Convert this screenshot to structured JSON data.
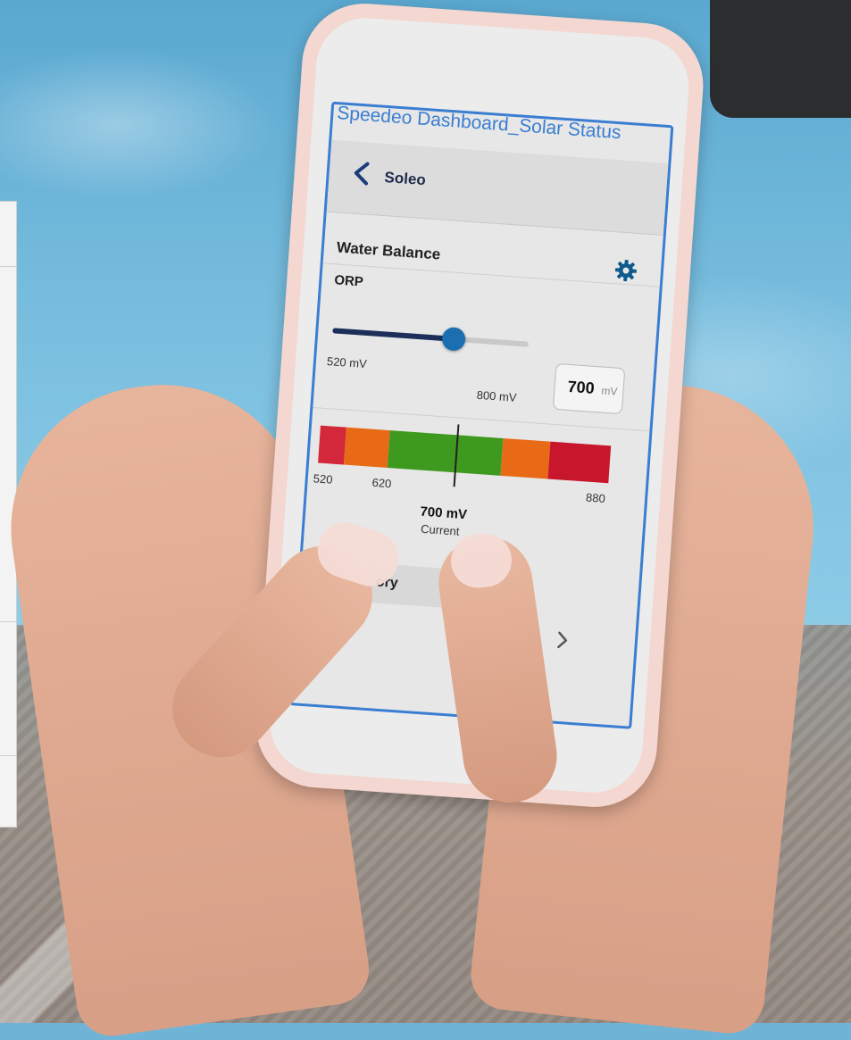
{
  "screen": {
    "title": "Speedeo Dashboard_Solar Status",
    "appbar": {
      "title": "Soleo",
      "back_icon": "chevron-left-icon"
    },
    "settings_icon": "gear-icon"
  },
  "water_balance": {
    "section_title": "Water Balance",
    "parameter_label": "ORP",
    "slider": {
      "min_label": "520 mV",
      "max_label": "800 mV",
      "value_fraction": 0.62
    },
    "setpoint": {
      "value": "700",
      "unit": "mV"
    }
  },
  "scale": {
    "ticks": [
      "520",
      "620",
      "880"
    ],
    "current_value": "700 mV",
    "current_label": "Current",
    "marker_fraction": 0.47,
    "segments": [
      {
        "color": "#d3283a",
        "fraction": 0.09
      },
      {
        "color": "#e86a16",
        "fraction": 0.15
      },
      {
        "color": "#3e9a1e",
        "fraction": 0.39
      },
      {
        "color": "#e86a16",
        "fraction": 0.16
      },
      {
        "color": "#c8172d",
        "fraction": 0.21
      }
    ]
  },
  "history": {
    "label": "ory"
  },
  "colors": {
    "accent": "#3a7ed2",
    "slider_fill": "#1c2f5a",
    "slider_thumb": "#1b6fb0",
    "gear": "#0f5a8c"
  }
}
